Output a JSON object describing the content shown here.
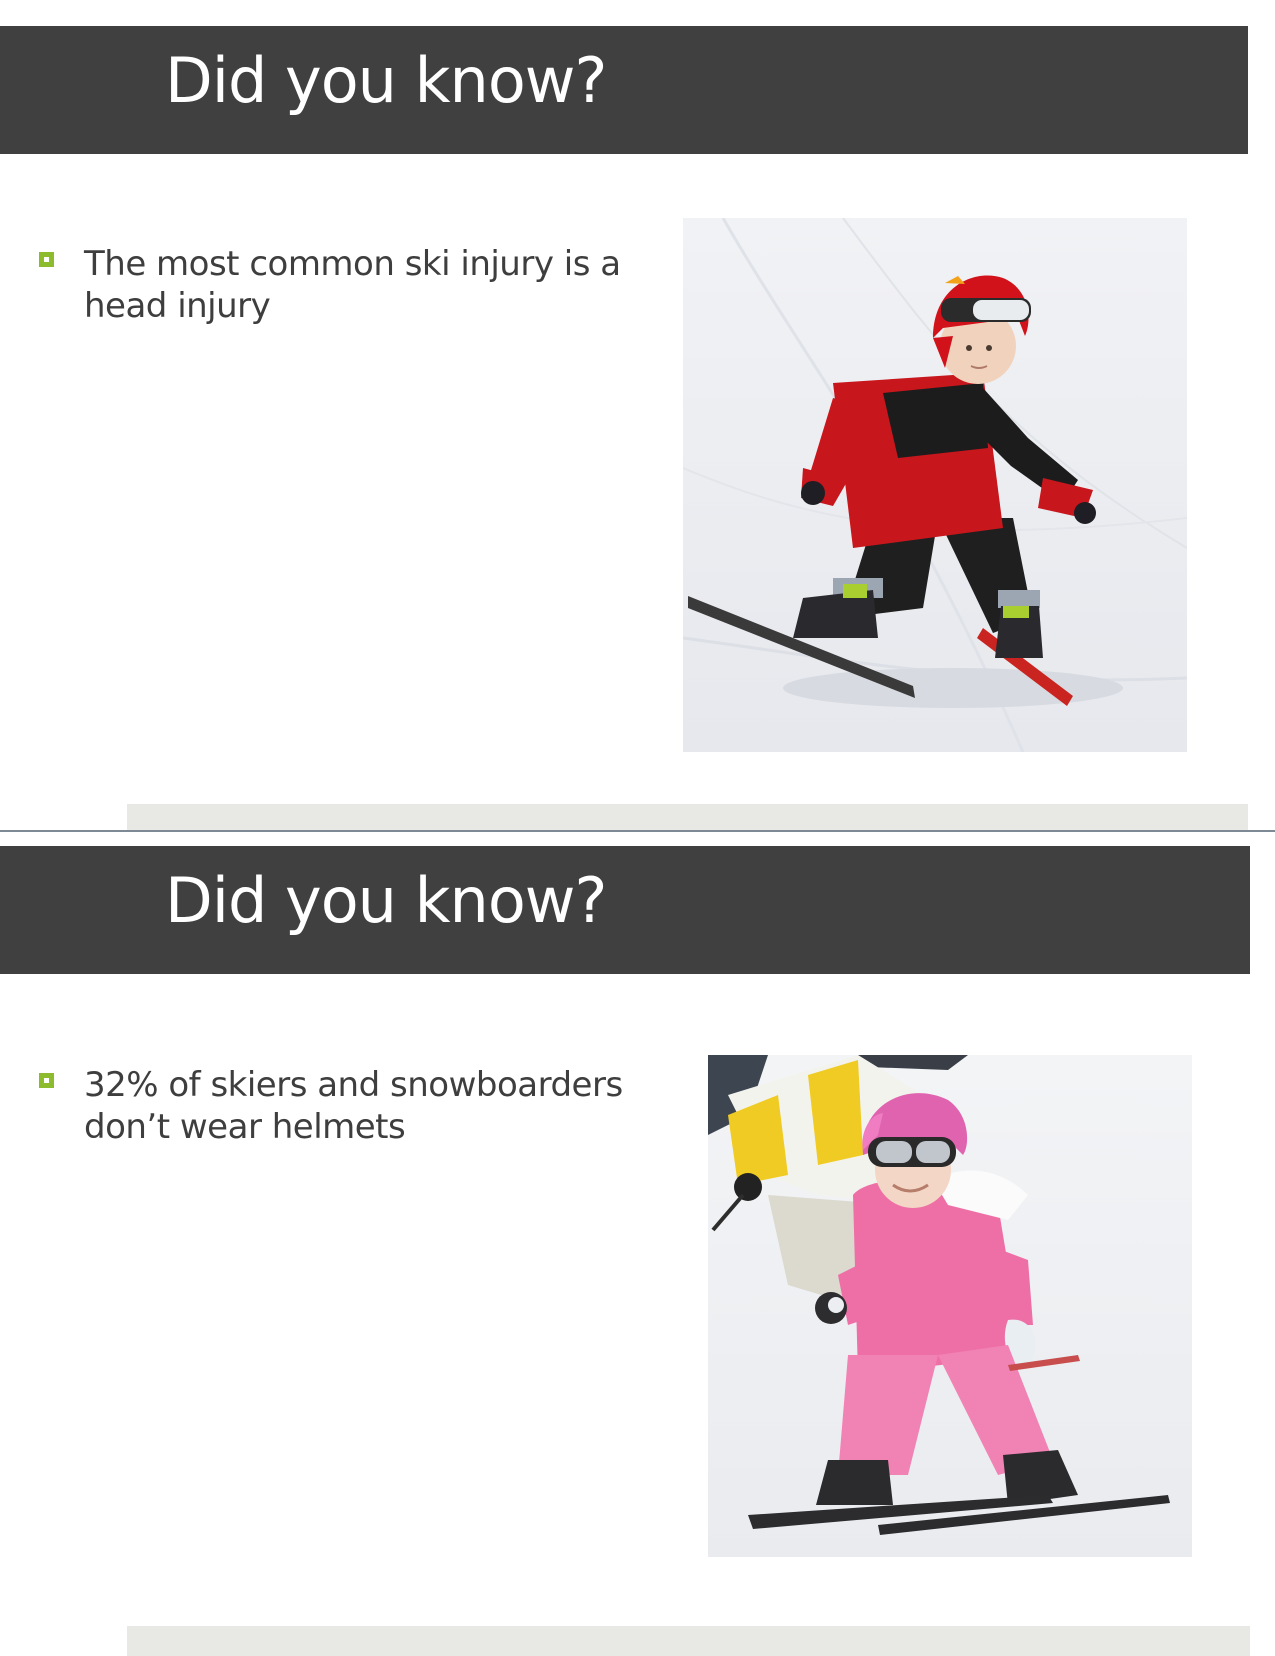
{
  "slides": [
    {
      "title": "Did you know?",
      "bullet": "The most common ski injury is a head injury",
      "image": {
        "icon": "child-skier-red-helmet-photo",
        "colors": {
          "suit": "#c8161d",
          "snow": "#f4f5f7"
        }
      }
    },
    {
      "title": "Did you know?",
      "bullet": "32% of skiers and snowboarders don’t wear helmets",
      "image": {
        "icon": "child-skier-pink-helmet-photo",
        "colors": {
          "suit": "#ee6fa6",
          "snow": "#f4f5f7"
        }
      }
    }
  ],
  "theme": {
    "title_bar": "#404040",
    "bullet_accent": "#8dbb2e",
    "footer_band": "#e8e9e4",
    "divider": "#7d8a96"
  }
}
